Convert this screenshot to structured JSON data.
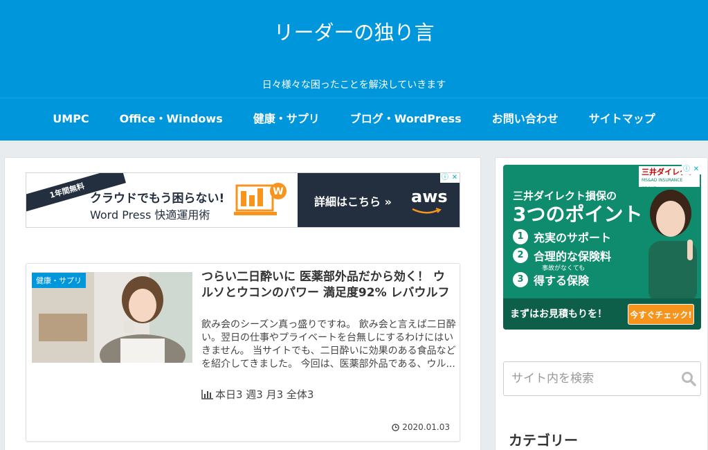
{
  "header": {
    "title": "リーダーの独り言",
    "description": "日々様々な困ったことを解決していきます"
  },
  "nav": {
    "items": [
      {
        "label": "UMPC"
      },
      {
        "label": "Office・Windows"
      },
      {
        "label": "健康・サプリ"
      },
      {
        "label": "ブログ・WordPress"
      },
      {
        "label": "お問い合わせ"
      },
      {
        "label": "サイトマップ"
      }
    ]
  },
  "ad_aws": {
    "ribbon": "1年間無料",
    "line1": "クラウドでもう困らない!",
    "line2": "Word Press 快適運用術",
    "cta": "詳細はこちら »",
    "logo": "aws"
  },
  "article": {
    "category": "健康・サプリ",
    "title": "つらい二日酔いに 医薬部外品だから効く！ ウルソとウコンのパワー 満足度92% レバウルフ",
    "excerpt": "飲み会のシーズン真っ盛りですね。 飲み会と言えば二日酔い。翌日の仕事やプライベートを台無しにするわけにはいきません。 当サイトでも、二日酔いに効果のある食品などを紹介してきました。 今回は、医薬部外品である、ウル...",
    "stats": "本日3 週3 月3 全体3",
    "date": "2020.01.03"
  },
  "ad_mitsui": {
    "logo": "三井ダイレクト",
    "logo_sub": "MS&AD INSURANCE GROUP",
    "line1": "三井ダイレクト損保の",
    "line2": "3つのポイント",
    "points": [
      "充実のサポート",
      "合理的な保険料",
      "得する保険"
    ],
    "point_numbers": [
      "1",
      "2",
      "3"
    ],
    "note": "事故がなくても",
    "bottom": "まずはお見積もりを！",
    "cta": "今すぐチェック!"
  },
  "search": {
    "placeholder": "サイト内を検索"
  },
  "widget": {
    "category_title": "カテゴリー"
  },
  "colors": {
    "brand": "#0096dc",
    "aws_dark": "#232f3e",
    "mitsui_green": "#0e8c6d",
    "cta_orange": "#f7941d"
  }
}
